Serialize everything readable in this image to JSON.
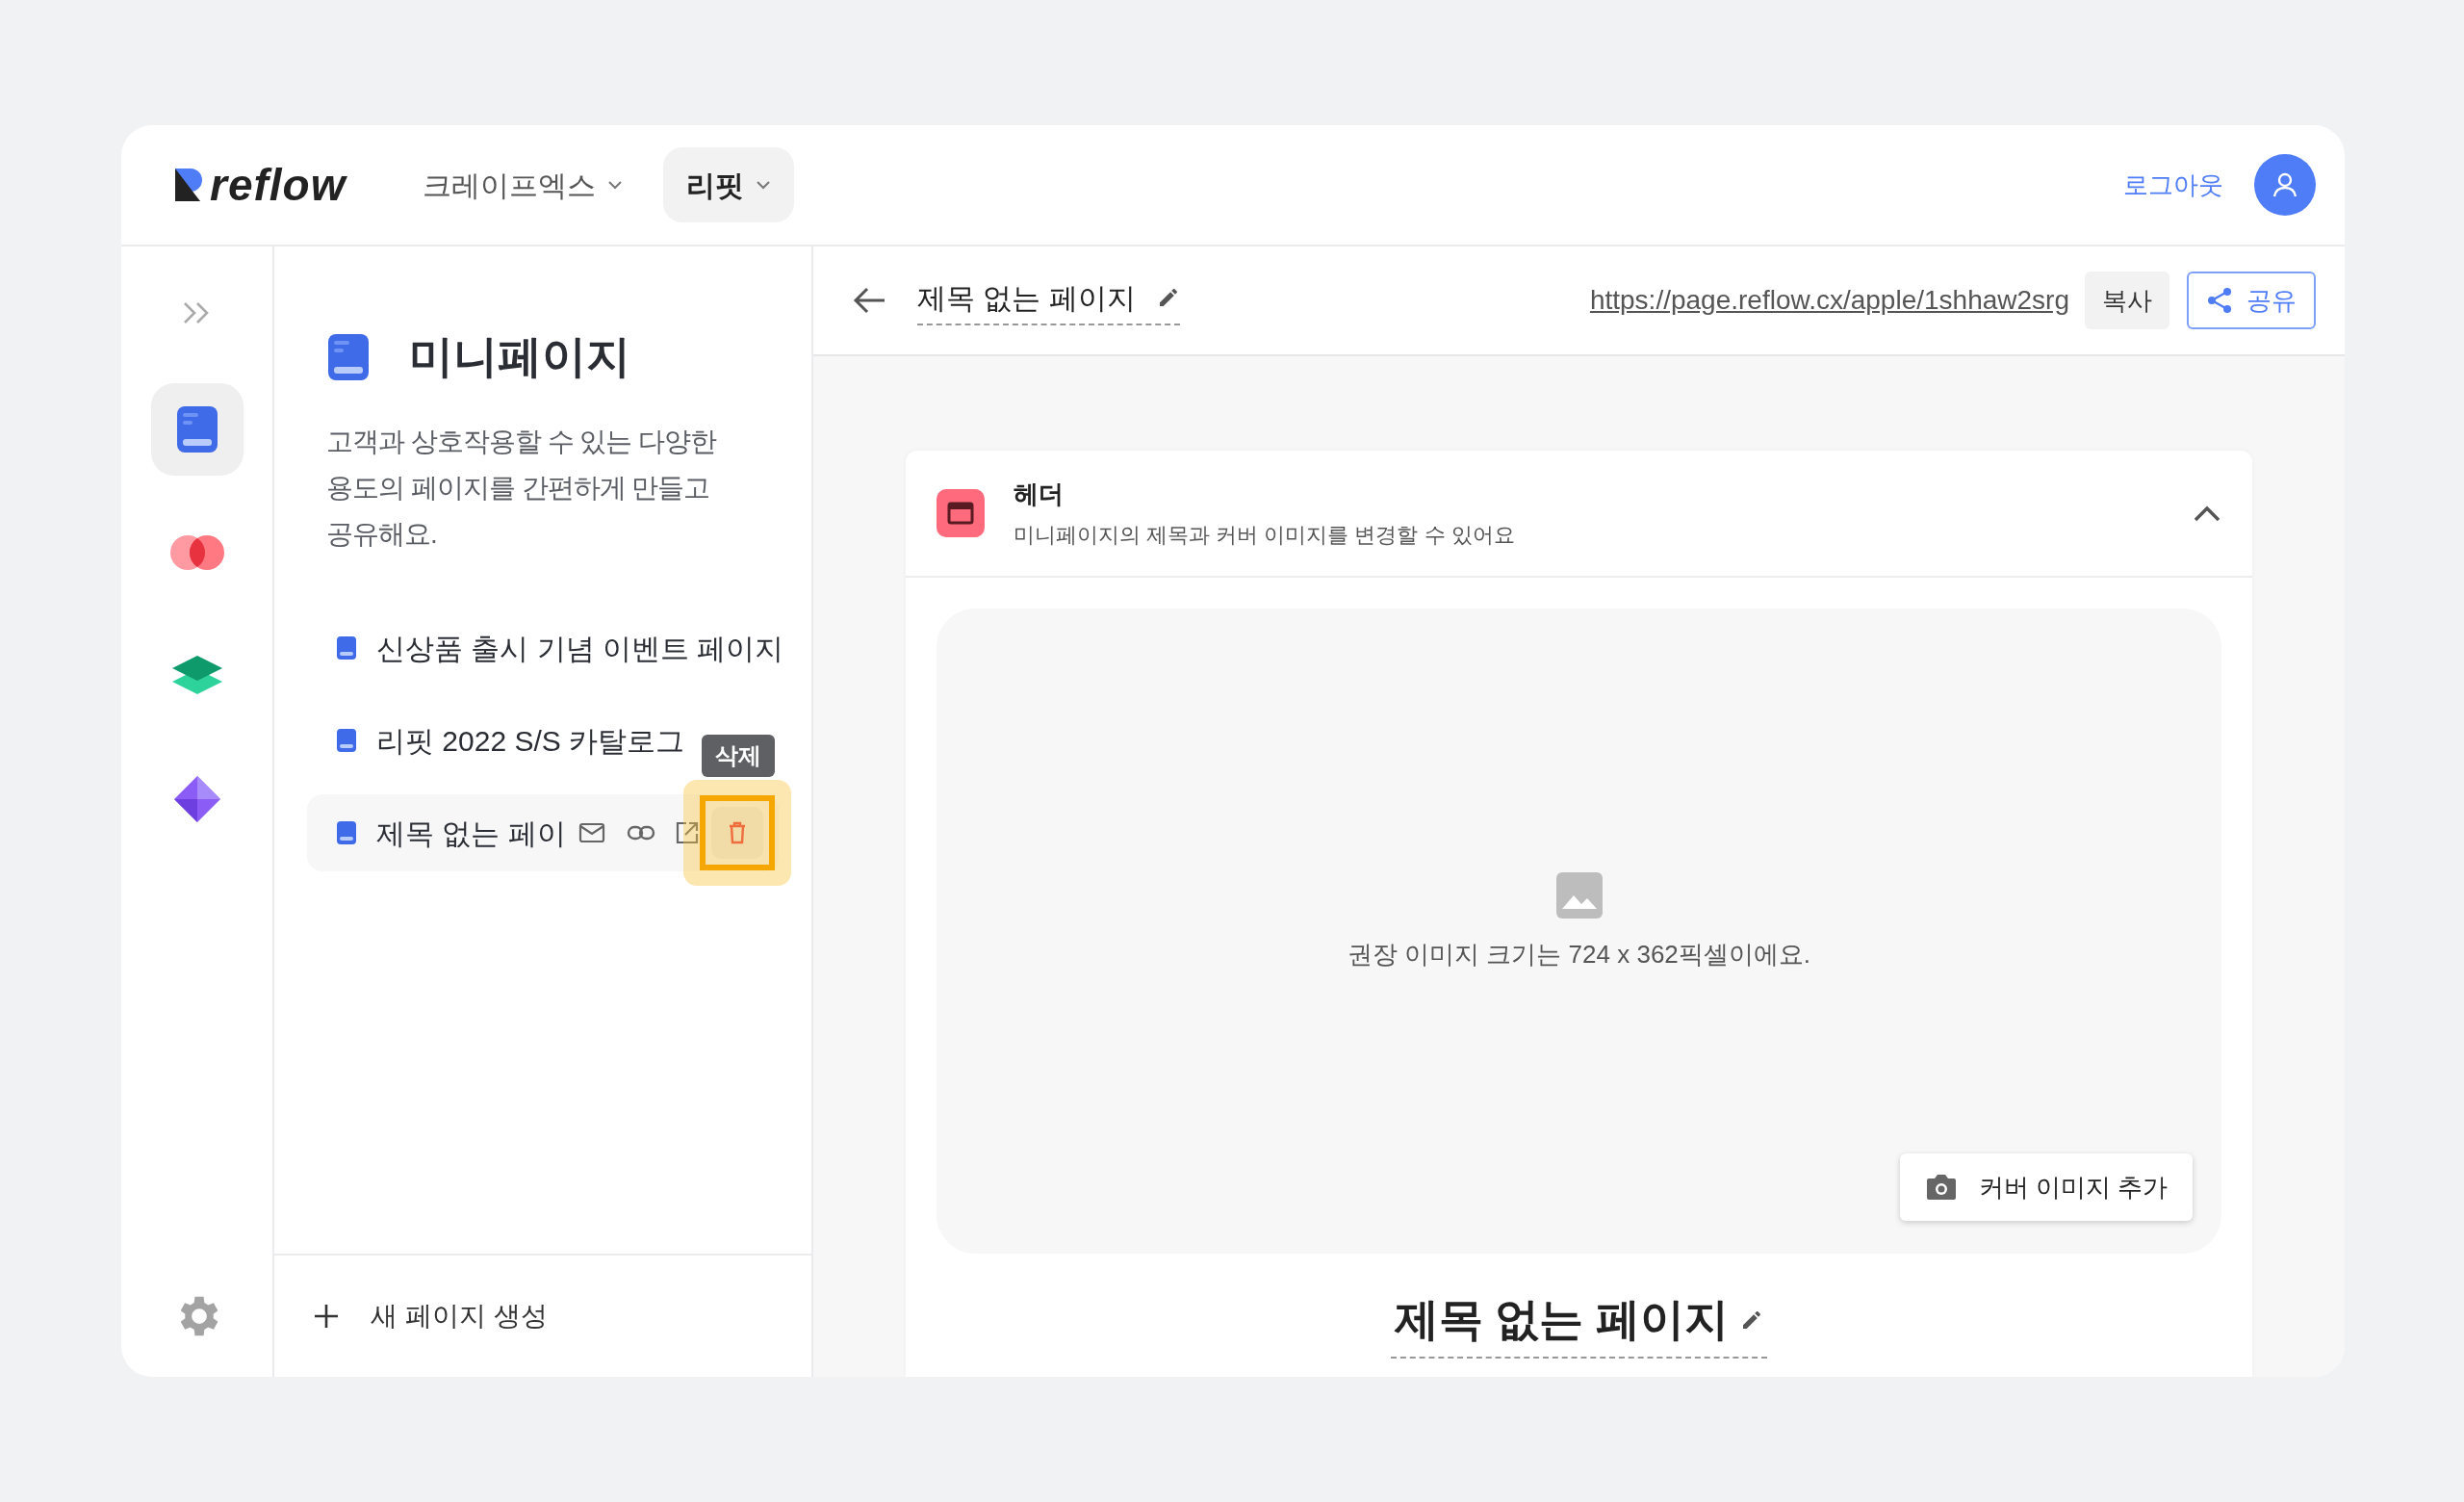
{
  "header": {
    "logo": "reflow",
    "workspaces": [
      {
        "label": "크레이프엑스",
        "selected": false
      },
      {
        "label": "리핏",
        "selected": true
      }
    ],
    "logout": "로그아웃"
  },
  "rail": {
    "items": [
      {
        "kind": "minipage",
        "selected": true
      },
      {
        "kind": "circles",
        "selected": false
      },
      {
        "kind": "layers",
        "selected": false
      },
      {
        "kind": "puzzle",
        "selected": false
      }
    ]
  },
  "panel": {
    "title": "미니페이지",
    "description": "고객과 상호작용할 수 있는 다양한 용도의 페이지를 간편하게 만들고 공유해요.",
    "pages": [
      {
        "title": "신상품 출시 기념 이벤트 페이지",
        "selected": false
      },
      {
        "title": "리핏 2022 S/S 카탈로그",
        "selected": false
      },
      {
        "title": "제목 없는 페이",
        "selected": true
      }
    ],
    "tooltip": "삭제",
    "new_page": "새 페이지 생성"
  },
  "editor": {
    "title": "제목 없는 페이지",
    "url": "https://page.reflow.cx/apple/1shhaw2srg",
    "copy": "복사",
    "share": "공유",
    "section": {
      "title": "헤더",
      "subtitle": "미니페이지의 제목과 커버 이미지를 변경할 수 있어요",
      "expanded": true
    },
    "cover": {
      "hint": "권장 이미지 크기는 724 x 362픽셀이에요.",
      "button": "커버 이미지 추가"
    },
    "page_title": "제목 없는 페이지"
  }
}
